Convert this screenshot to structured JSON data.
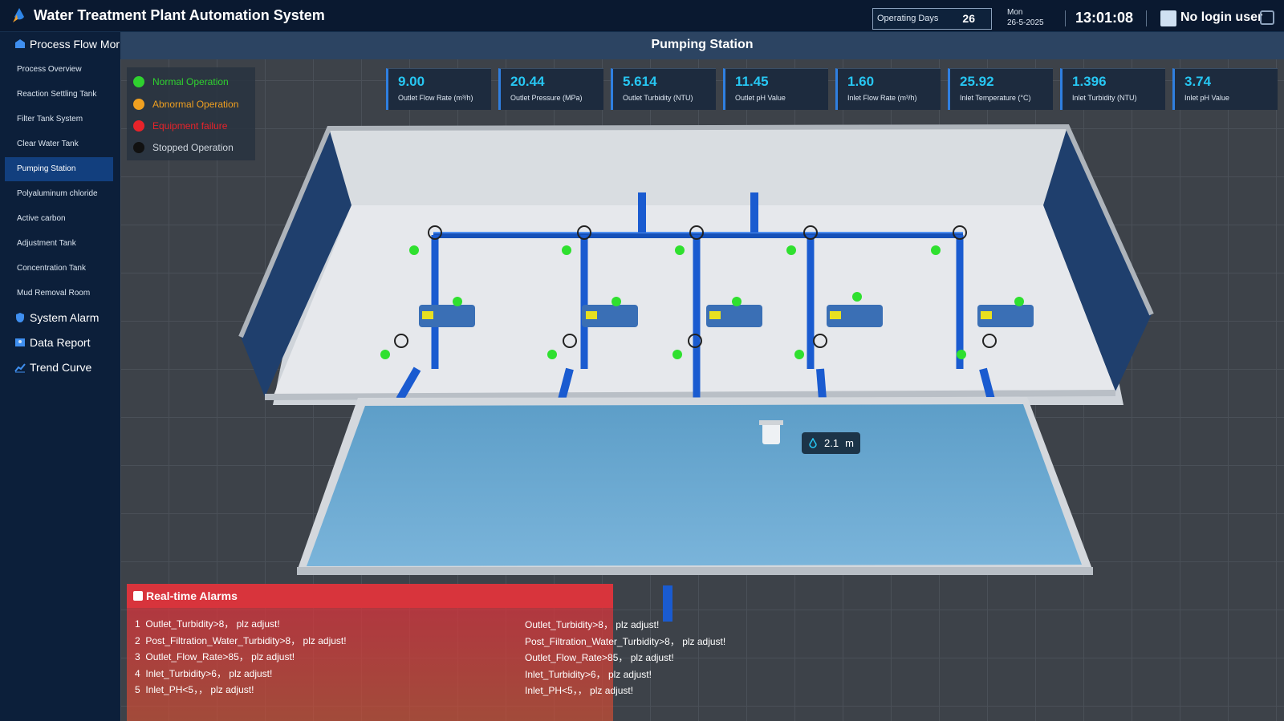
{
  "header": {
    "app_title": "Water Treatment Plant Automation System",
    "operating_days_label": "Operating Days",
    "operating_days_value": "26",
    "date_day": "Mon",
    "date": "26-5-2025",
    "time": "13:01:08",
    "user": "No login user"
  },
  "sidebar": {
    "sections": [
      {
        "label": "Process Flow Mor",
        "icon": "process-icon"
      },
      {
        "label": "System Alarm",
        "icon": "alarm-shield-icon"
      },
      {
        "label": "Data Report",
        "icon": "report-icon"
      },
      {
        "label": "Trend Curve",
        "icon": "trend-icon"
      }
    ],
    "items": [
      {
        "label": "Process Overview",
        "active": false
      },
      {
        "label": "Reaction Settling Tank",
        "active": false
      },
      {
        "label": "Filter Tank System",
        "active": false
      },
      {
        "label": "Clear Water Tank",
        "active": false
      },
      {
        "label": "Pumping Station",
        "active": true
      },
      {
        "label": "Polyaluminum chloride",
        "active": false
      },
      {
        "label": "Active carbon",
        "active": false
      },
      {
        "label": "Adjustment Tank",
        "active": false
      },
      {
        "label": "Concentration Tank",
        "active": false
      },
      {
        "label": "Mud Removal Room",
        "active": false
      }
    ]
  },
  "page": {
    "title": "Pumping Station"
  },
  "legend": [
    {
      "label": "Normal Operation",
      "color": "#2fd12f"
    },
    {
      "label": "Abnormal Operation",
      "color": "#f0a020"
    },
    {
      "label": "Equipment failure",
      "color": "#e8232a"
    },
    {
      "label": "Stopped Operation",
      "color": "#111111"
    }
  ],
  "metrics": [
    {
      "value": "9.00",
      "label": "Outlet Flow Rate (m³/h)"
    },
    {
      "value": "20.44",
      "label": "Outlet Pressure (MPa)"
    },
    {
      "value": "5.614",
      "label": "Outlet Turbidity (NTU)"
    },
    {
      "value": "11.45",
      "label": "Outlet pH Value"
    },
    {
      "value": "1.60",
      "label": "Inlet Flow Rate (m³/h)"
    },
    {
      "value": "25.92",
      "label": "Inlet Temperature (°C)"
    },
    {
      "value": "1.396",
      "label": "Inlet Turbidity (NTU)"
    },
    {
      "value": "3.74",
      "label": "Inlet pH Value"
    }
  ],
  "level": {
    "value": "2.1",
    "unit": "m"
  },
  "alarms": {
    "title": "Real-time Alarms",
    "rows": [
      {
        "index": "1",
        "message": "Outlet_Turbidity>8， plz adjust!",
        "detail": "Outlet_Turbidity>8， plz adjust!"
      },
      {
        "index": "2",
        "message": "Post_Filtration_Water_Turbidity>8， plz adjust!",
        "detail": "Post_Filtration_Water_Turbidity>8， plz adjust!"
      },
      {
        "index": "3",
        "message": "Outlet_Flow_Rate>85， plz adjust!",
        "detail": "Outlet_Flow_Rate>85， plz adjust!"
      },
      {
        "index": "4",
        "message": "Inlet_Turbidity>6， plz adjust!",
        "detail": "Inlet_Turbidity>6， plz adjust!"
      },
      {
        "index": "5",
        "message": "Inlet_PH<5，， plz adjust!",
        "detail": "Inlet_PH<5，， plz adjust!"
      }
    ]
  },
  "colors": {
    "accent": "#27c6f2",
    "active_nav": "#123f7e",
    "alarm": "#d8343c",
    "water": "#6aa8d0"
  }
}
